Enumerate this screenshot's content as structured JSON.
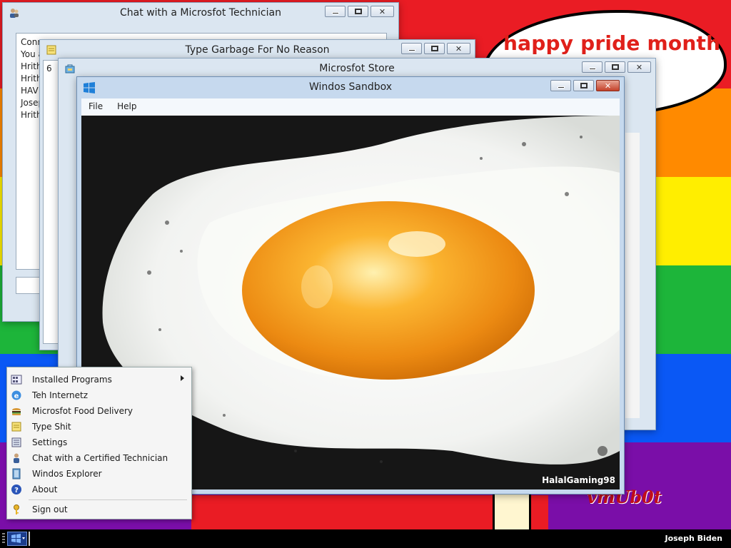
{
  "colors": {
    "red": "#ea1c24",
    "orange": "#ff8a00",
    "yellow": "#ffee00",
    "green": "#1db53a",
    "blue": "#0a58f5",
    "purple": "#7a0ea8",
    "cloud_text": "#e0201a"
  },
  "desktop": {
    "cloud_text": "happy pride month",
    "bottom_text": "vmUb0t"
  },
  "windows": {
    "chat": {
      "title": "Chat with a Microsfot Technician",
      "icon": "technician-icon",
      "lines": [
        "Conn",
        "You a",
        "Hrith",
        "Hrith",
        "HAV",
        "Josep",
        "Hrith"
      ]
    },
    "typer": {
      "title": "Type Garbage For No Reason",
      "icon": "notepad-icon",
      "content": "6"
    },
    "store": {
      "title": "Microsfot Store",
      "icon": "store-icon"
    },
    "sandbox": {
      "title": "Windos Sandbox",
      "icon": "windows-logo-icon",
      "menu": [
        "File",
        "Help"
      ],
      "image_caption": "HalalGaming98"
    }
  },
  "start_menu": {
    "items": [
      {
        "label": "Installed Programs",
        "icon": "programs-icon",
        "submenu": true
      },
      {
        "label": "Teh Internetz",
        "icon": "internet-explorer-icon"
      },
      {
        "label": "Microsfot Food Delivery",
        "icon": "burger-icon"
      },
      {
        "label": "Type Shit",
        "icon": "notepad-icon"
      },
      {
        "label": "Settings",
        "icon": "settings-icon"
      },
      {
        "label": "Chat with a Certified Technician",
        "icon": "technician-icon"
      },
      {
        "label": "Windos Explorer",
        "icon": "explorer-icon"
      },
      {
        "label": "About",
        "icon": "help-icon"
      },
      {
        "label": "Sign out",
        "icon": "key-icon"
      }
    ]
  },
  "taskbar": {
    "user_name": "Joseph Biden"
  }
}
